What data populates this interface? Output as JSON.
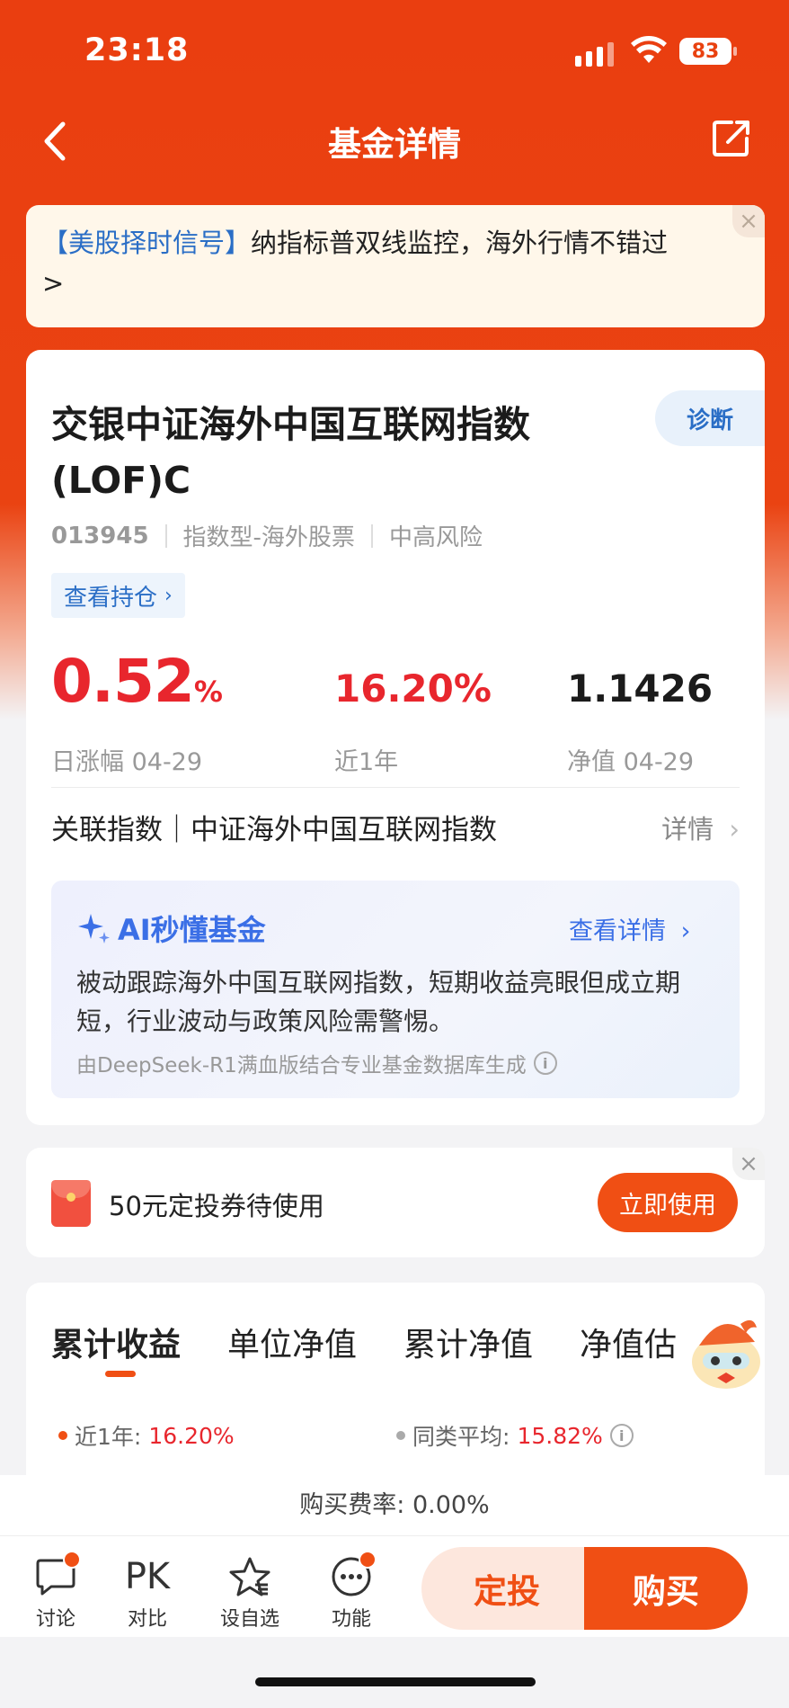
{
  "status_bar": {
    "time": "23:18",
    "battery": "83"
  },
  "nav": {
    "title": "基金详情"
  },
  "banner": {
    "highlight": "【美股择时信号】",
    "text": "纳指标普双线监控，海外行情不错过",
    "arrow": ">",
    "close": "×"
  },
  "fund": {
    "name": "交银中证海外中国互联网指数(LOF)C",
    "diagnose_label": "诊断",
    "code": "013945",
    "type": "指数型-海外股票",
    "risk": "中高风险",
    "holdings_link": "查看持仓",
    "daily_change": "0.52",
    "daily_change_unit": "%",
    "daily_change_label": "日涨幅 04-29",
    "one_year": "16.20%",
    "one_year_label": "近1年",
    "nav_value": "1.1426",
    "nav_label": "净值 04-29",
    "index_label": "关联指数｜中证海外中国互联网指数",
    "index_detail": "详情"
  },
  "ai_card": {
    "title": "AI秒懂基金",
    "link": "查看详情",
    "body": "被动跟踪海外中国互联网指数，短期收益亮眼但成立期短，行业波动与政策风险需警惕。",
    "footer": "由DeepSeek-R1满血版结合专业基金数据库生成"
  },
  "coupon": {
    "text": "50元定投券待使用",
    "button": "立即使用",
    "close": "×"
  },
  "chart_tabs": [
    "累计收益",
    "单位净值",
    "累计净值",
    "净值估"
  ],
  "legend": {
    "fund_label": "近1年:",
    "fund_value": "16.20%",
    "fund_color": "#f04f14",
    "avg_label": "同类平均:",
    "avg_value": "15.82%",
    "avg_color": "#aaaaaa"
  },
  "fee": {
    "text": "购买费率: 0.00%"
  },
  "bottom_bar": {
    "discuss": "讨论",
    "compare_icon": "PK",
    "compare": "对比",
    "watchlist": "设自选",
    "functions": "功能",
    "invest_button": "定投",
    "buy_button": "购买"
  },
  "colors": {
    "brand": "#ea3e10",
    "accent": "#f04f14",
    "rise": "#e8262d",
    "link": "#2a6ec6"
  }
}
